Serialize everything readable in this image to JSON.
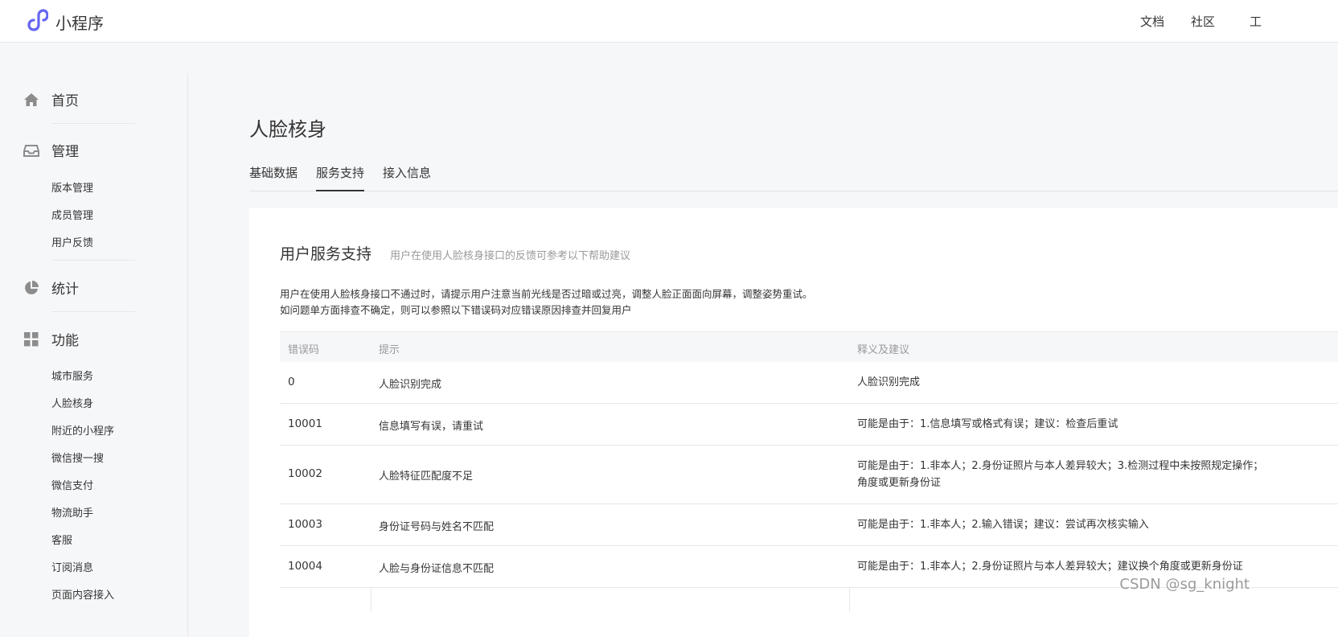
{
  "header": {
    "app_name": "小程序",
    "links": [
      "文档",
      "社区",
      "工"
    ]
  },
  "sidebar": {
    "groups": [
      {
        "label": "首页",
        "icon": "home-icon"
      },
      {
        "label": "管理",
        "icon": "inbox-icon",
        "items": [
          "版本管理",
          "成员管理",
          "用户反馈"
        ]
      },
      {
        "label": "统计",
        "icon": "pie-chart-icon"
      },
      {
        "label": "功能",
        "icon": "grid-icon",
        "items": [
          "城市服务",
          "人脸核身",
          "附近的小程序",
          "微信搜一搜",
          "微信支付",
          "物流助手",
          "客服",
          "订阅消息",
          "页面内容接入"
        ]
      }
    ]
  },
  "main": {
    "title": "人脸核身",
    "tabs": [
      "基础数据",
      "服务支持",
      "接入信息"
    ],
    "active_tab": "服务支持",
    "card": {
      "title": "用户服务支持",
      "desc": "用户在使用人脸核身接口的反馈可参考以下帮助建议",
      "intro": [
        "用户在使用人脸核身接口不通过时，请提示用户注意当前光线是否过暗或过亮，调整人脸正面面向屏幕，调整姿势重试。",
        "如问题单方面排查不确定，则可以参照以下错误码对应错误原因排查并回复用户"
      ],
      "table": {
        "headers": [
          "错误码",
          "提示",
          "释义及建议"
        ],
        "rows": [
          {
            "code": "0",
            "tip": "人脸识别完成",
            "advice": [
              "人脸识别完成"
            ]
          },
          {
            "code": "10001",
            "tip": "信息填写有误，请重试",
            "advice": [
              "可能是由于：1.信息填写或格式有误；建议：检查后重试"
            ]
          },
          {
            "code": "10002",
            "tip": "人脸特征匹配度不足",
            "advice": [
              "可能是由于：1.非本人；2.身份证照片与本人差异较大；3.检测过程中未按照规定操作；",
              "角度或更新身份证"
            ]
          },
          {
            "code": "10003",
            "tip": "身份证号码与姓名不匹配",
            "advice": [
              "可能是由于：1.非本人；2.输入错误；建议：尝试再次核实输入"
            ]
          },
          {
            "code": "10004",
            "tip": "人脸与身份证信息不匹配",
            "advice": [
              "可能是由于：1.非本人；2.身份证照片与本人差异较大；建议换个角度或更新身份证"
            ]
          }
        ]
      }
    }
  },
  "watermark": "CSDN @sg_knight",
  "colors": {
    "brand": "#6467f0",
    "text": "#353535",
    "muted": "#9a9a9a",
    "background": "#f6f7f9",
    "icon": "#8c8c8c"
  }
}
